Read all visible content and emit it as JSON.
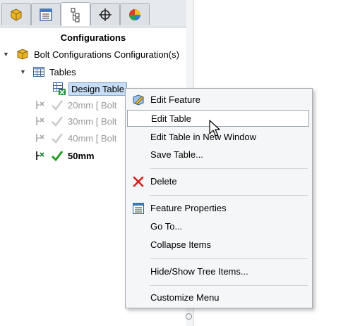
{
  "tabs": [
    {
      "icon": "feature-manager-tab-icon",
      "active": false
    },
    {
      "icon": "property-manager-tab-icon",
      "active": false
    },
    {
      "icon": "configuration-manager-tab-icon",
      "active": true
    },
    {
      "icon": "dimxpert-manager-tab-icon",
      "active": false
    },
    {
      "icon": "display-manager-tab-icon",
      "active": false
    }
  ],
  "panel": {
    "title": "Configurations",
    "root_label": "Bolt Configurations Configuration(s)",
    "tables_label": "Tables",
    "design_table_label": "Design Table",
    "configs": [
      {
        "label": "20mm [ Bolt",
        "active": false
      },
      {
        "label": "30mm [ Bolt",
        "active": false
      },
      {
        "label": "40mm [ Bolt",
        "active": false
      },
      {
        "label": "50mm",
        "active": true
      }
    ]
  },
  "context_menu": {
    "items": [
      {
        "label": "Edit Feature",
        "icon": "edit-feature-icon"
      },
      {
        "label": "Edit Table",
        "icon": "",
        "hover": true
      },
      {
        "label": "Edit Table in New Window",
        "icon": ""
      },
      {
        "label": "Save Table...",
        "icon": ""
      },
      {
        "label": "Delete",
        "icon": "delete-icon"
      },
      {
        "label": "Feature Properties",
        "icon": "feature-properties-icon"
      },
      {
        "label": "Go To...",
        "icon": ""
      },
      {
        "label": "Collapse Items",
        "icon": ""
      },
      {
        "label": "Hide/Show Tree Items...",
        "icon": ""
      },
      {
        "label": "Customize Menu",
        "icon": ""
      }
    ]
  },
  "colors": {
    "selection": "#c7ddf5",
    "active_check": "#1a9a1a",
    "delete_red": "#d42020"
  }
}
